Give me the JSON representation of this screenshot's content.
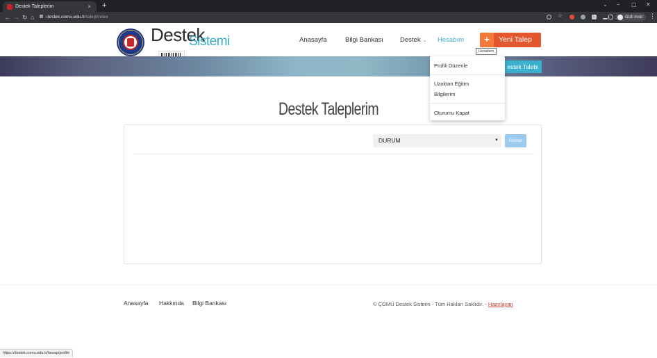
{
  "browser": {
    "tab_title": "Destek Taleplerim",
    "tab_close": "×",
    "new_tab": "+",
    "url_host": "destek.comu.edu.tr",
    "url_path": "/talep/index",
    "incognito_label": "Gizli mod",
    "status_url": "https://destek.comu.edu.tr/hesap/profile"
  },
  "header": {
    "logo_destek": "Destek",
    "logo_sistemi": "Sistemi",
    "nav": {
      "anasayfa": "Anasayfa",
      "bilgi_bankasi": "Bilgi Bankası",
      "destek": "Destek",
      "hesabim": "Hesabım"
    },
    "new_request": "Yeni Talep",
    "new_request_plus": "+",
    "tooltip": "Hesabım"
  },
  "banner": {
    "button_label": "estek Talebi"
  },
  "account_menu": {
    "items": [
      "Profili Düzenle",
      "Uzaktan Eğitim",
      "Bilgilerim",
      "Oturumu Kapat"
    ]
  },
  "main": {
    "title": "Destek Taleplerim",
    "filter_select": "DURUM",
    "show_button": "Göster"
  },
  "footer": {
    "links": [
      "Anasayfa",
      "Hakkında",
      "Bilgi Bankası"
    ],
    "copyright": "© ÇOMÜ Destek Sistemi - Tüm Hakları Saklıdır. - ",
    "prepared_by": "Hazırlayan"
  },
  "colors": {
    "accent": "#3aa9c8",
    "new_request": "#e4572e",
    "show_button": "#9cc9ee"
  }
}
